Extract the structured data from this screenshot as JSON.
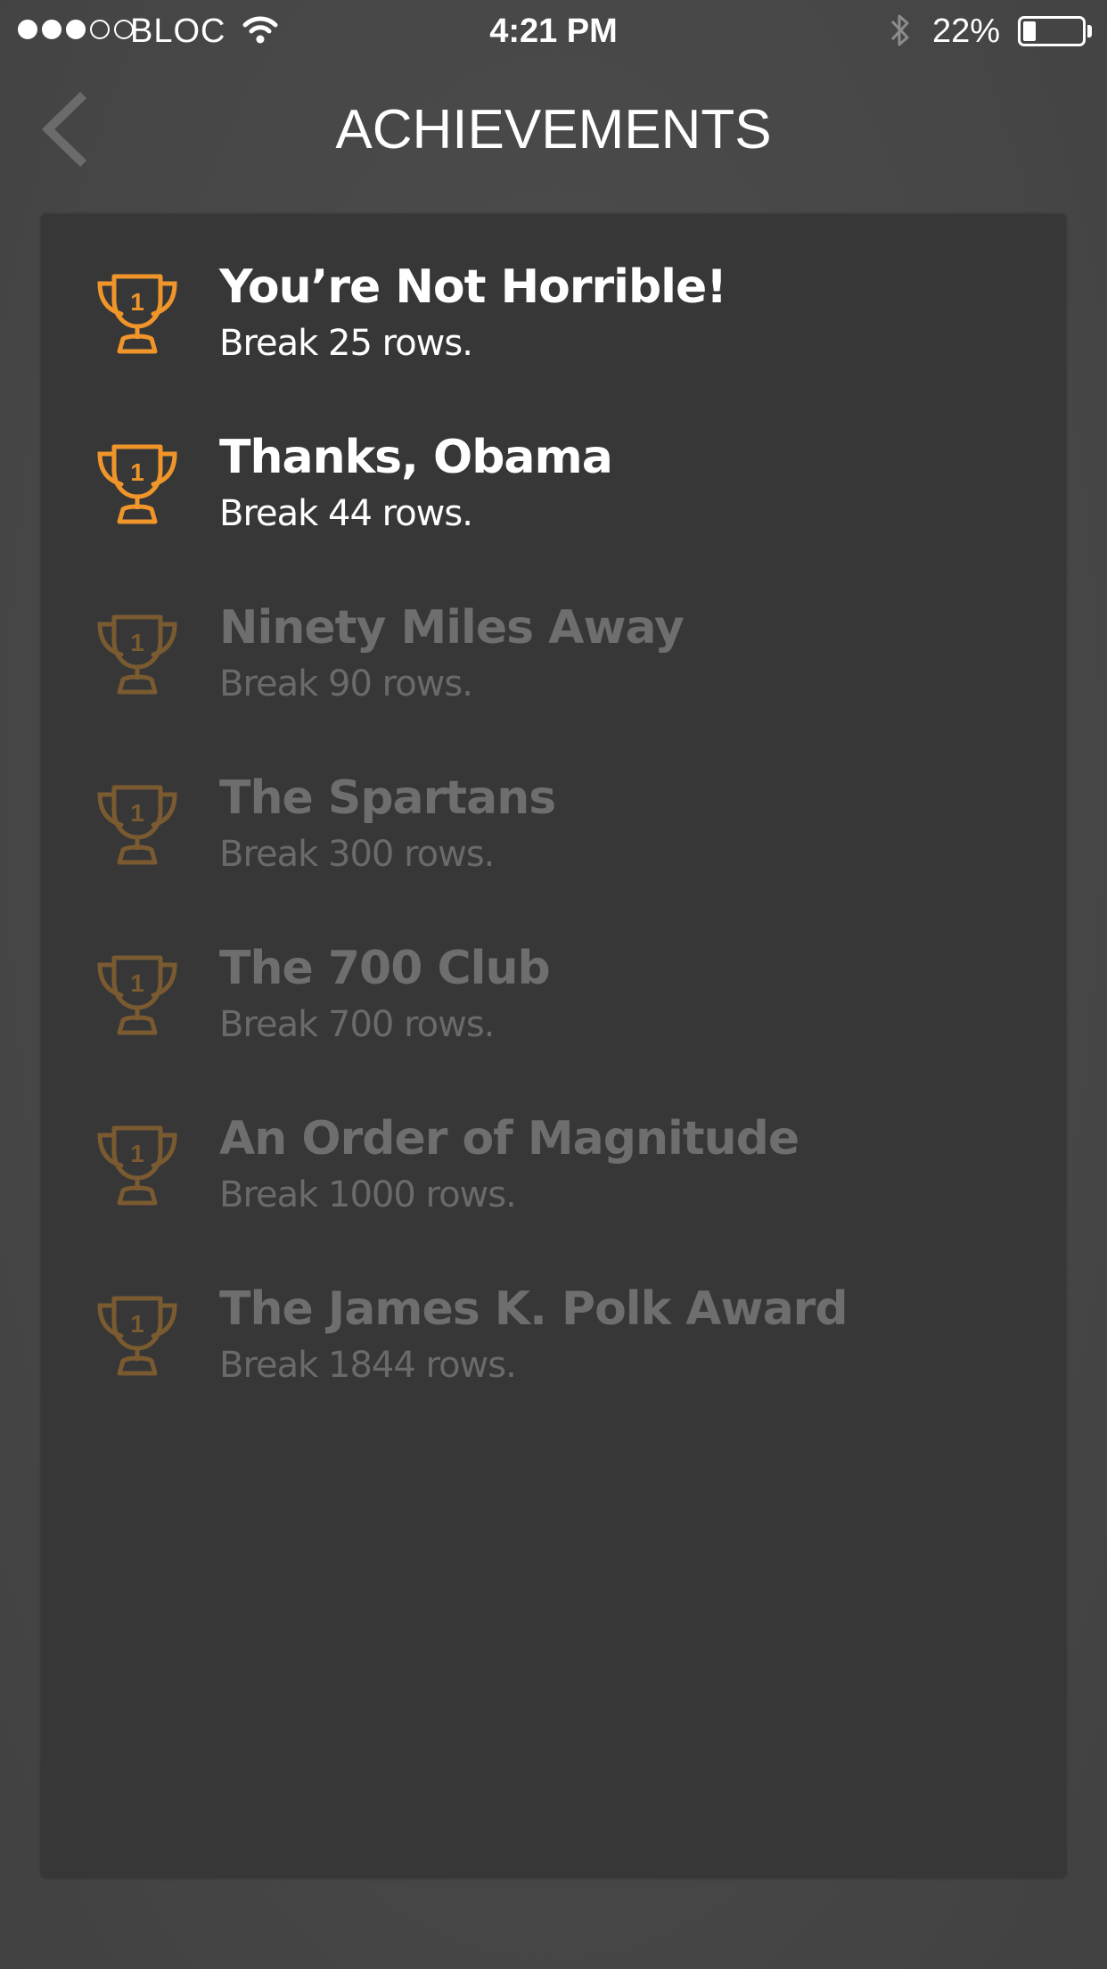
{
  "status_bar": {
    "carrier": "BLOC",
    "time": "4:21 PM",
    "battery_percent": "22%",
    "battery_level": 0.22,
    "signal_bars_filled": 3,
    "signal_bars_total": 5
  },
  "header": {
    "title": "ACHIEVEMENTS",
    "back_icon": "chevron-left-icon"
  },
  "colors": {
    "unlocked_trophy": "#f0952a",
    "locked_trophy": "#7a5a30",
    "panel": "#373737",
    "background": "#474747"
  },
  "achievements": [
    {
      "title": "You’re Not Horrible!",
      "description": "Break 25 rows.",
      "unlocked": true
    },
    {
      "title": "Thanks, Obama",
      "description": "Break 44 rows.",
      "unlocked": true
    },
    {
      "title": "Ninety Miles Away",
      "description": "Break 90 rows.",
      "unlocked": false
    },
    {
      "title": "The Spartans",
      "description": "Break 300 rows.",
      "unlocked": false
    },
    {
      "title": "The 700 Club",
      "description": "Break 700 rows.",
      "unlocked": false
    },
    {
      "title": "An Order of Magnitude",
      "description": "Break 1000 rows.",
      "unlocked": false
    },
    {
      "title": "The James K. Polk Award",
      "description": "Break 1844 rows.",
      "unlocked": false
    }
  ],
  "trophy_label": "1"
}
